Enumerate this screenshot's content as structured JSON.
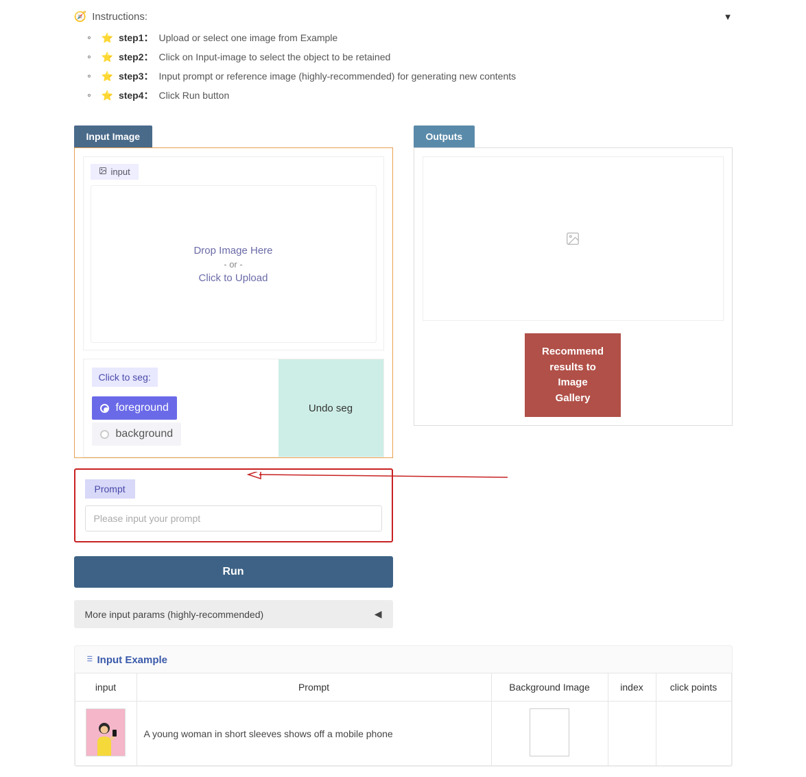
{
  "instructions": {
    "label": "Instructions:",
    "steps": [
      {
        "label": "step1：",
        "text": "Upload or select one image from Example"
      },
      {
        "label": "step2：",
        "text": "Click on Input-image to select the object to be retained"
      },
      {
        "label": "step3：",
        "text": "Input prompt or reference image (highly-recommended) for generating new contents"
      },
      {
        "label": "step4：",
        "text": "Click Run button"
      }
    ]
  },
  "inputImage": {
    "tab_label": "Input Image",
    "badge": "input",
    "drop_text": "Drop Image Here",
    "or_text": "- or -",
    "click_text": "Click to Upload"
  },
  "seg": {
    "label": "Click to seg:",
    "foreground": "foreground",
    "background": "background",
    "undo": "Undo seg"
  },
  "outputs": {
    "tab_label": "Outputs",
    "recommend": "Recommend results to Image Gallery"
  },
  "prompt": {
    "label": "Prompt",
    "placeholder": "Please input your prompt"
  },
  "run_label": "Run",
  "more_params": "More input params (highly-recommended)",
  "example": {
    "header": "Input Example",
    "columns": [
      "input",
      "Prompt",
      "Background Image",
      "index",
      "click points"
    ],
    "row1_prompt": "A young woman in short sleeves shows off a mobile phone"
  }
}
